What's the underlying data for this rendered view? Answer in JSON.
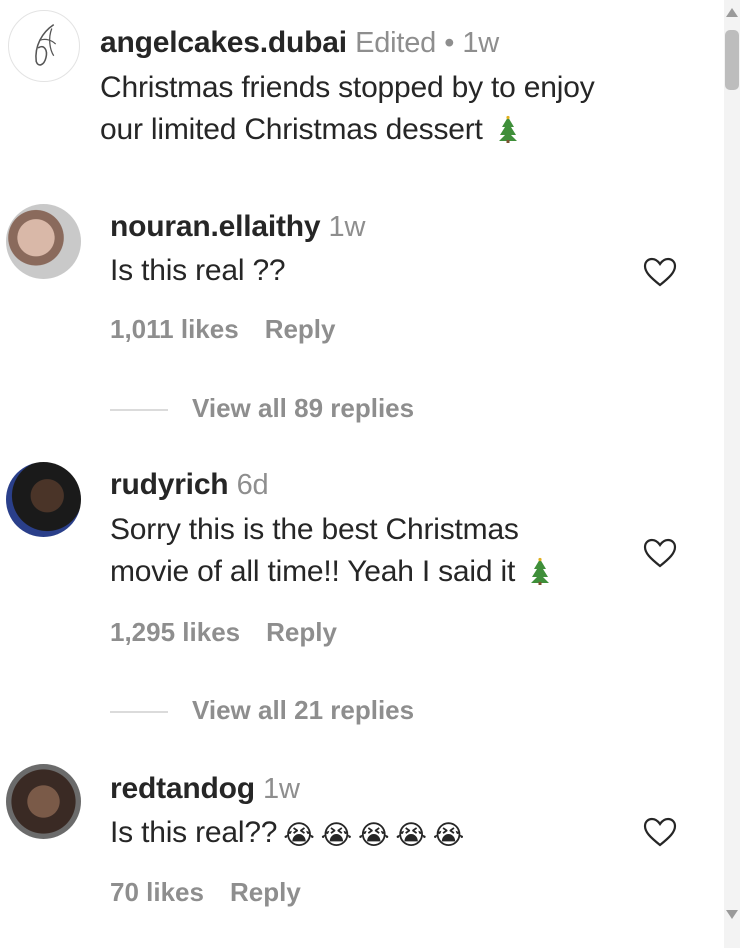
{
  "caption": {
    "username": "angelcakes.dubai",
    "edited": "Edited",
    "separator": "•",
    "time": "1w",
    "line1": "Christmas friends stopped by to enjoy",
    "line2": "our limited Christmas dessert",
    "emoji_icon": "christmas-tree-icon"
  },
  "comments": [
    {
      "username": "nouran.ellaithy",
      "time": "1w",
      "lines": [
        "Is this real ??"
      ],
      "likes": "1,011 likes",
      "reply": "Reply",
      "view_replies": "View all 89 replies"
    },
    {
      "username": "rudyrich",
      "time": "6d",
      "lines": [
        "Sorry this is the best Christmas",
        "movie of all time!! Yeah I said it"
      ],
      "likes": "1,295 likes",
      "reply": "Reply",
      "view_replies": "View all 21 replies"
    },
    {
      "username": "redtandog",
      "time": "1w",
      "lines": [
        "Is this real??"
      ],
      "emojis": [
        "😭",
        "😭",
        "😭",
        "😭",
        "😭"
      ],
      "likes": "70 likes",
      "reply": "Reply"
    }
  ],
  "colors": {
    "text": "#262626",
    "secondary": "#8e8e8e",
    "divider": "#dbdbdb",
    "tree_green": "#3f8f3a"
  }
}
